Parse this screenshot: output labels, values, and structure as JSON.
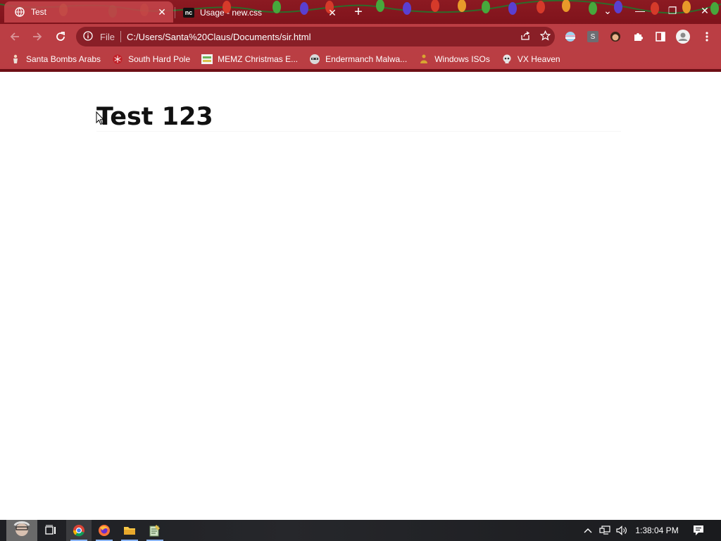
{
  "browser": {
    "tabs": [
      {
        "title": "Test",
        "active": true,
        "icon": "globe-icon"
      },
      {
        "title": "Usage - new.css",
        "active": false,
        "icon": "nc",
        "icon_text": "nc"
      }
    ],
    "new_tab_symbol": "+",
    "window_controls": {
      "tab_search": "⌄",
      "minimize": "—",
      "restore": "❐",
      "close": "✕"
    },
    "address_bar": {
      "scheme_label": "File",
      "url": "C:/Users/Santa%20Claus/Documents/sir.html"
    },
    "extensions": [
      {
        "name": "striped-extension-icon"
      },
      {
        "name": "s-extension-icon",
        "label": "S"
      },
      {
        "name": "avatar-extension-icon"
      },
      {
        "name": "puzzle-icon"
      },
      {
        "name": "side-panel-icon"
      },
      {
        "name": "profile-icon"
      },
      {
        "name": "kebab-menu-icon"
      }
    ],
    "bookmarks": [
      {
        "label": "Santa Bombs Arabs",
        "icon": "figure-icon"
      },
      {
        "label": "South Hard Pole",
        "icon": "snowflake-icon"
      },
      {
        "label": "MEMZ Christmas E...",
        "icon": "memz-icon"
      },
      {
        "label": "Endermanch Malwa...",
        "icon": "raccoon-icon"
      },
      {
        "label": "Windows ISOs",
        "icon": "buddha-icon"
      },
      {
        "label": "VX Heaven",
        "icon": "skull-icon"
      }
    ]
  },
  "page": {
    "heading": "Test 123"
  },
  "taskbar": {
    "clock": "1:38:04 PM",
    "apps": [
      {
        "name": "task-view"
      },
      {
        "name": "chrome",
        "active": true
      },
      {
        "name": "firefox"
      },
      {
        "name": "file-explorer"
      },
      {
        "name": "notepad"
      }
    ]
  },
  "colors": {
    "chrome_dark": "#7a1119",
    "chrome_tab": "#c4444a",
    "page_background": "#ffffff",
    "heading_text": "#111111",
    "taskbar": "#1e1f23"
  }
}
